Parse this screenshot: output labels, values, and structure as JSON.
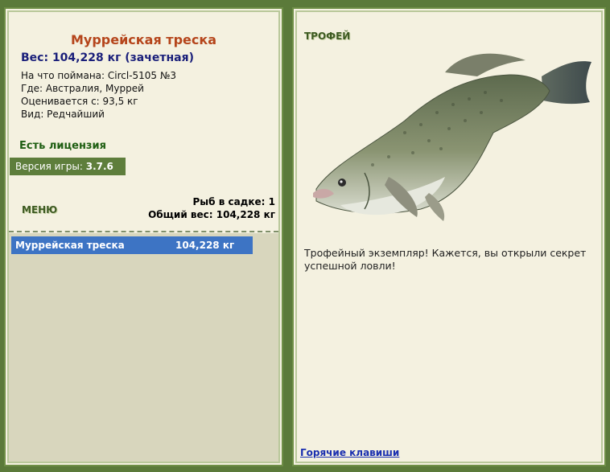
{
  "fish": {
    "name": "Муррейская треска",
    "weight_line": "Вес: 104,228 кг (зачетная)",
    "caught_with": "На что поймана: Circl-5105 №3",
    "location": "Где: Австралия, Муррей",
    "valued_from": "Оценивается с: 93,5 кг",
    "species": "Вид: Редчайший"
  },
  "license": "Есть лицензия",
  "version": {
    "label": "Версия игры: ",
    "number": "3.7.6"
  },
  "menu": {
    "label": "МЕНЮ"
  },
  "stats": {
    "count_line": "Рыб в садке: 1",
    "total_weight_line": "Общий вес: 104,228 кг"
  },
  "keepnet": {
    "items": [
      {
        "name": "Муррейская треска",
        "weight": "104,228 кг"
      }
    ]
  },
  "trophy": {
    "label": "ТРОФЕЙ",
    "message": "Трофейный экземпляр! Кажется, вы открыли секрет успешной ловли!"
  },
  "hotkeys_label": "Горячие клавиши",
  "colors": {
    "frame": "#5b7a3a",
    "panel": "#f4f1e0",
    "title": "#b5451b",
    "weight": "#1a1f7a",
    "license": "#1e5e12",
    "selected_row": "#3d74c4",
    "link": "#1a2fb0"
  },
  "icons": {
    "fish_image": "murray-cod-fish-image"
  }
}
